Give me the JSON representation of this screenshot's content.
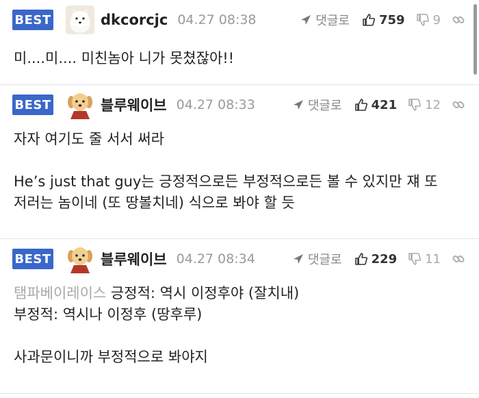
{
  "comments": [
    {
      "badge": "BEST",
      "avatar": "samoyed-dog-avatar",
      "nickname": "dkcorcjc",
      "date": "04.27 08:38",
      "reply_label": "댓글로",
      "upvotes": "759",
      "downvotes": "9",
      "lines": [
        "미....미.... 미친놈아 니가 못쳤잖아!!"
      ]
    },
    {
      "badge": "BEST",
      "avatar": "golden-puppy-avatar",
      "nickname": "블루웨이브",
      "date": "04.27 08:33",
      "reply_label": "댓글로",
      "upvotes": "421",
      "downvotes": "12",
      "lines": [
        "자자 여기도 줄 서서 써라",
        "",
        "He’s just that guy는 긍정적으로든 부정적으로든 볼 수 있지만 쟤 또",
        "저러는 놈이네 (또 땅볼치네) 식으로 봐야 할 듯"
      ]
    },
    {
      "badge": "BEST",
      "avatar": "golden-puppy-avatar",
      "nickname": "블루웨이브",
      "date": "04.27 08:34",
      "reply_label": "댓글로",
      "upvotes": "229",
      "downvotes": "11",
      "reply_tag": "탬파베이레이스",
      "lines": [
        " 긍정적: 역시 이정후야 (잘치내)",
        "부정적: 역시나 이정후 (땅후루)",
        "",
        "사과문이니까 부정적으로 봐야지"
      ]
    }
  ],
  "colors": {
    "badge": "#3a67c9",
    "muted": "#9a9a9a",
    "tag": "#a9a9a9"
  },
  "icons": {
    "reply": "reply-arrow-icon",
    "up": "thumbs-up-icon",
    "down": "thumbs-down-icon",
    "more": "link-icon"
  }
}
